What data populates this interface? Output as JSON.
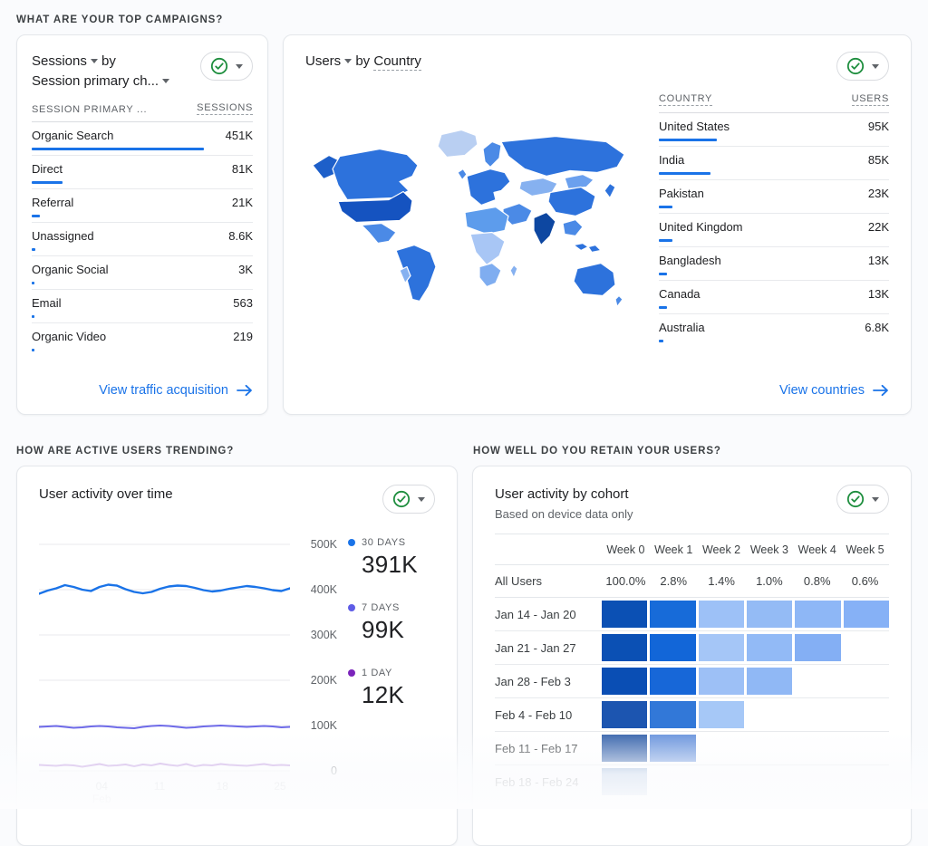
{
  "colors": {
    "accent_blue": "#1a73e8",
    "check_green": "#1e8e3e",
    "legend_30d": "#1a73e8",
    "legend_7d": "#5e5ce6",
    "legend_1d": "#7b24bb"
  },
  "sections": {
    "top_campaigns": "WHAT ARE YOUR TOP CAMPAIGNS?",
    "active_users": "HOW ARE ACTIVE USERS TRENDING?",
    "retention": "HOW WELL DO YOU RETAIN YOUR USERS?"
  },
  "cards": {
    "sessions": {
      "metric": "Sessions",
      "by": "by",
      "dimension": "Session primary ch...",
      "col_dimension": "SESSION PRIMARY ...",
      "col_metric": "SESSIONS",
      "link": "View traffic acquisition"
    },
    "countries": {
      "metric": "Users",
      "by": "by",
      "dimension": "Country",
      "col_dimension": "COUNTRY",
      "col_metric": "USERS",
      "link": "View countries"
    },
    "activity": {
      "title": "User activity over time"
    },
    "cohort": {
      "title": "User activity by cohort",
      "subtitle": "Based on device data only"
    }
  },
  "chart_data": {
    "sessions_table": {
      "type": "table",
      "title": "Sessions by Session primary channel group",
      "columns": [
        "SESSION PRIMARY ...",
        "SESSIONS"
      ],
      "rows": [
        {
          "label": "Organic Search",
          "value": "451K",
          "pct": 78
        },
        {
          "label": "Direct",
          "value": "81K",
          "pct": 14
        },
        {
          "label": "Referral",
          "value": "21K",
          "pct": 3.6
        },
        {
          "label": "Unassigned",
          "value": "8.6K",
          "pct": 1.5
        },
        {
          "label": "Organic Social",
          "value": "3K",
          "pct": 0.6
        },
        {
          "label": "Email",
          "value": "563",
          "pct": 0.2
        },
        {
          "label": "Organic Video",
          "value": "219",
          "pct": 0.1
        }
      ]
    },
    "countries_table": {
      "type": "table",
      "title": "Users by Country",
      "columns": [
        "COUNTRY",
        "USERS"
      ],
      "rows": [
        {
          "label": "United States",
          "value": "95K",
          "pct": 25
        },
        {
          "label": "India",
          "value": "85K",
          "pct": 22.5
        },
        {
          "label": "Pakistan",
          "value": "23K",
          "pct": 6
        },
        {
          "label": "United Kingdom",
          "value": "22K",
          "pct": 5.8
        },
        {
          "label": "Bangladesh",
          "value": "13K",
          "pct": 3.4
        },
        {
          "label": "Canada",
          "value": "13K",
          "pct": 3.4
        },
        {
          "label": "Australia",
          "value": "6.8K",
          "pct": 1.8
        }
      ]
    },
    "activity_line": {
      "type": "line",
      "title": "User activity over time",
      "ylim_k": [
        0,
        500
      ],
      "y_ticks": [
        "500K",
        "400K",
        "300K",
        "200K",
        "100K",
        "0"
      ],
      "x_ticks": [
        {
          "label": "04",
          "sub": "Feb"
        },
        {
          "label": "11",
          "sub": ""
        },
        {
          "label": "18",
          "sub": ""
        },
        {
          "label": "25",
          "sub": ""
        }
      ],
      "series": [
        {
          "name": "30 DAYS",
          "current": "391K",
          "color": "#1a73e8",
          "values_k": [
            391,
            398,
            403,
            410,
            406,
            400,
            397,
            406,
            411,
            409,
            401,
            395,
            392,
            395,
            402,
            407,
            409,
            408,
            404,
            399,
            396,
            398,
            402,
            405,
            408,
            406,
            403,
            399,
            397,
            403
          ]
        },
        {
          "name": "7 DAYS",
          "current": "99K",
          "color": "#6e6ae8",
          "values_k": [
            97,
            98,
            99,
            97,
            95,
            96,
            98,
            99,
            98,
            96,
            95,
            94,
            97,
            99,
            100,
            99,
            97,
            95,
            96,
            98,
            99,
            100,
            99,
            98,
            97,
            98,
            99,
            98,
            96,
            97
          ]
        },
        {
          "name": "1 DAY",
          "current": "12K",
          "color": "#b07fd6",
          "values_k": [
            13,
            12,
            11,
            13,
            12,
            9,
            12,
            15,
            11,
            12,
            14,
            10,
            14,
            12,
            16,
            13,
            11,
            15,
            10,
            13,
            12,
            15,
            13,
            12,
            11,
            13,
            15,
            12,
            13,
            12
          ]
        }
      ]
    },
    "cohort_heatmap": {
      "type": "heatmap",
      "title": "User activity by cohort",
      "columns": [
        "Week 0",
        "Week 1",
        "Week 2",
        "Week 3",
        "Week 4",
        "Week 5"
      ],
      "all_users": {
        "label": "All Users",
        "values": [
          "100.0%",
          "2.8%",
          "1.4%",
          "1.0%",
          "0.8%",
          "0.6%"
        ]
      },
      "rows": [
        {
          "label": "Jan 14 - Jan 20",
          "cells": [
            "#0b50b4",
            "#176bd9",
            "#9dc1f7",
            "#94bbf5",
            "#8eb7f6",
            "#86b1f6"
          ]
        },
        {
          "label": "Jan 21 - Jan 27",
          "cells": [
            "#0b50b4",
            "#1266d8",
            "#a5c6f7",
            "#92baf6",
            "#84aff4"
          ]
        },
        {
          "label": "Jan 28 - Feb 3",
          "cells": [
            "#0a4eb4",
            "#1767d8",
            "#9dc0f6",
            "#90b8f5"
          ]
        },
        {
          "label": "Feb 4 - Feb 10",
          "cells": [
            "#1c55b0",
            "#3278d8",
            "#a6c8f7"
          ]
        },
        {
          "label": "Feb 11 - Feb 17",
          "cells": [
            "#3a66ad",
            "#6b95dd"
          ]
        },
        {
          "label": "Feb 18 - Feb 24",
          "cells": [
            "#7d9fce"
          ]
        }
      ]
    }
  }
}
